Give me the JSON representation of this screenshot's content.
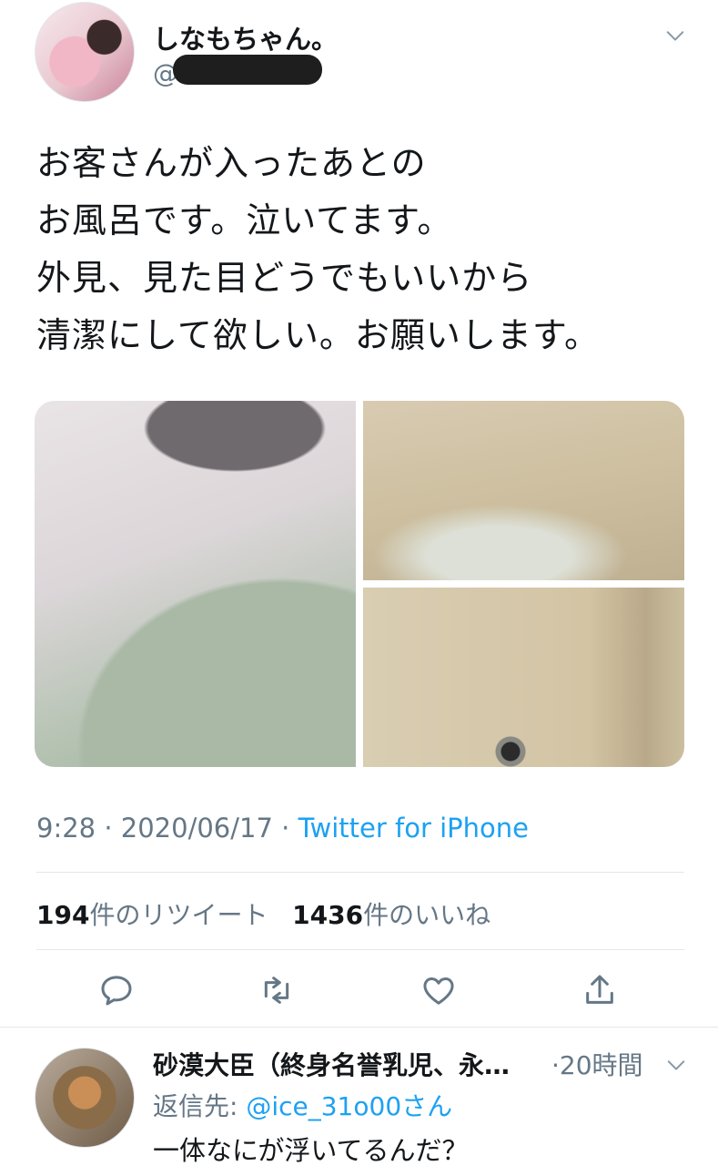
{
  "tweet": {
    "display_name": "しなもちゃん。",
    "handle": "@",
    "text_lines": [
      "お客さんが入ったあとの",
      "お風呂です。泣いてます。",
      "外見、見た目どうでもいいから",
      "清潔にして欲しい。お願いします。"
    ],
    "time": "9:28",
    "date": "2020/06/17",
    "separator": "·",
    "source": "Twitter for iPhone",
    "retweet_count": "194",
    "retweet_label": "件のリツイート",
    "like_count": "1436",
    "like_label": "件のいいね",
    "icons": {
      "more": "chevron-down-icon",
      "reply": "reply-icon",
      "retweet": "retweet-icon",
      "like": "heart-icon",
      "share": "share-icon"
    }
  },
  "reply": {
    "display_name": "砂漠大臣（終身名誉乳児、永…",
    "time": "·20時間",
    "reply_to_label": "返信先: ",
    "reply_to_mention": "@ice_31o00さん",
    "text": "一体なにが浮いてるんだ？"
  },
  "colors": {
    "accent": "#1da1f2",
    "secondary_text": "#657786",
    "primary_text": "#14171a",
    "divider": "#e1e8ed"
  }
}
